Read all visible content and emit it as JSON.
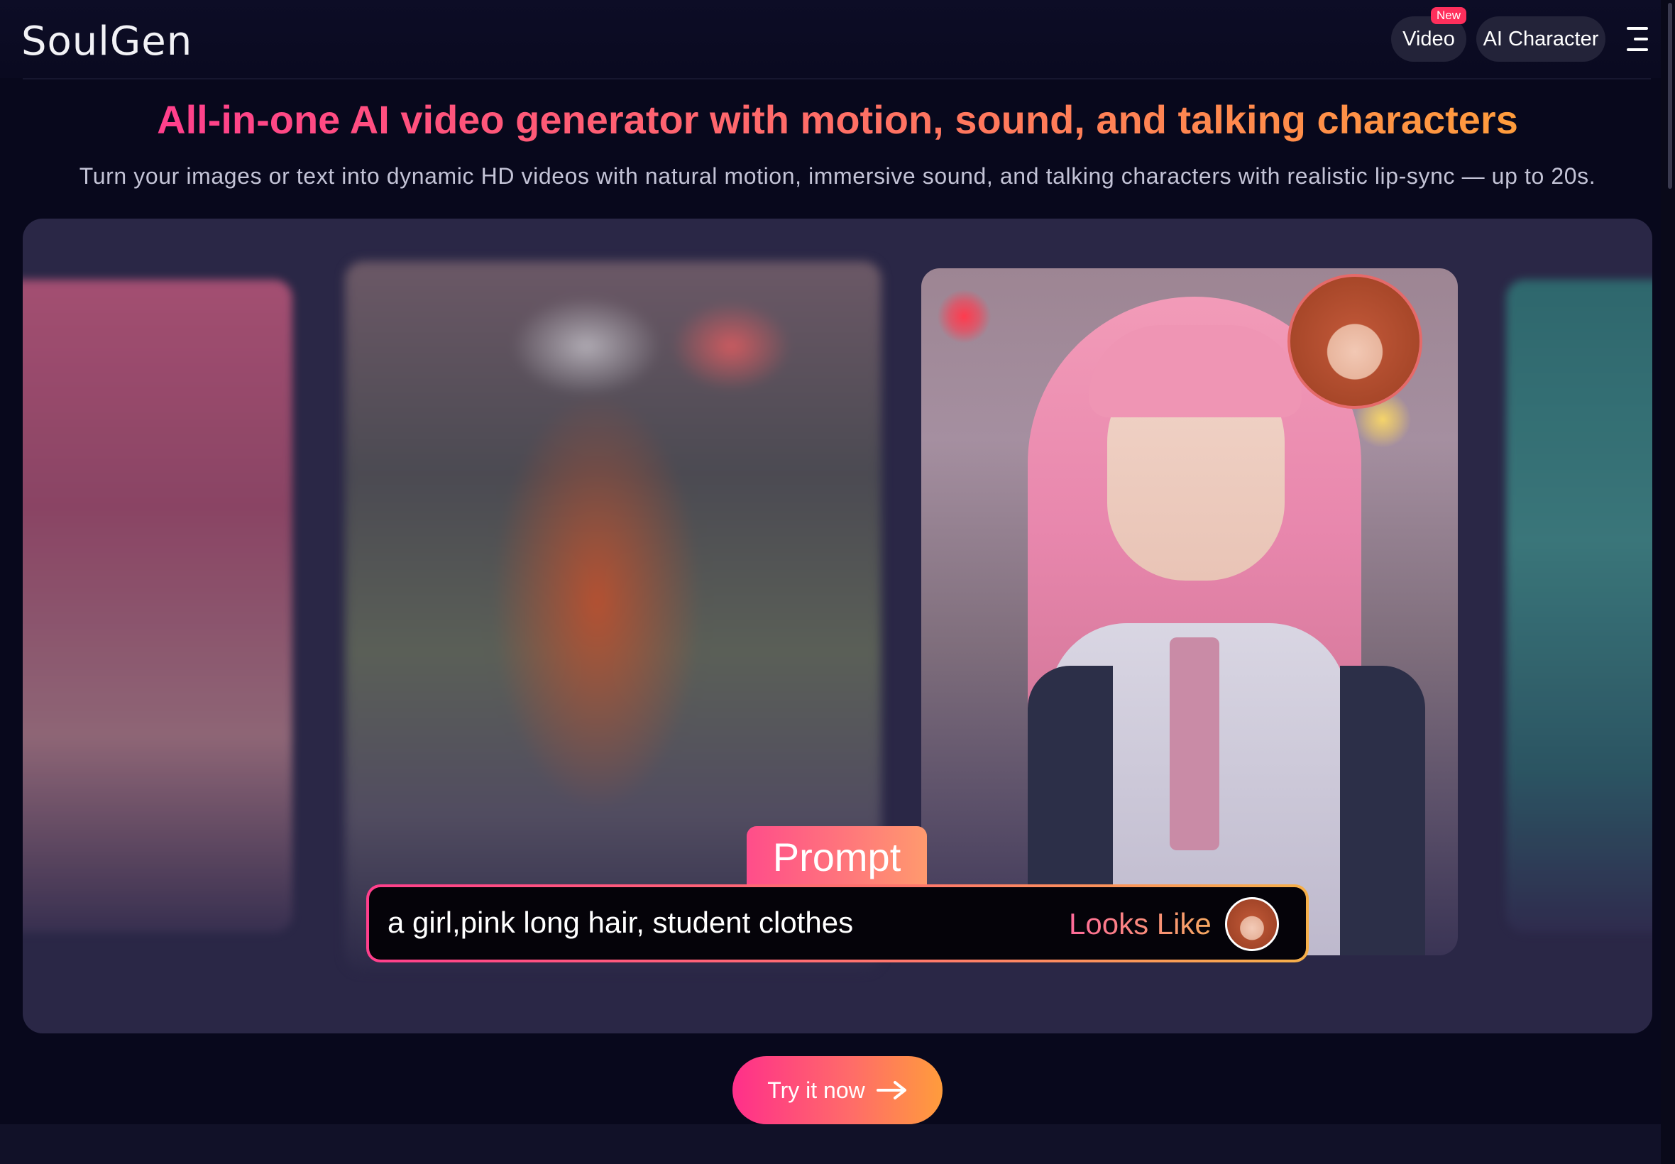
{
  "header": {
    "logo": "SoulGen",
    "nav": {
      "video_label": "Video",
      "video_badge": "New",
      "ai_character_label": "AI Character"
    },
    "menu_icon": "hamburger-menu-icon"
  },
  "hero": {
    "headline": "All-in-one AI video generator with motion, sound, and talking characters",
    "subheadline": "Turn your images or text into dynamic HD videos with natural motion, immersive sound, and talking characters with realistic lip-sync — up to 20s."
  },
  "showcase": {
    "prompt_tab": "Prompt",
    "prompt_text": "a girl,pink long hair, student clothes",
    "looks_like_label": "Looks Like"
  },
  "cta": {
    "label": "Try it now",
    "icon": "arrow-right-icon"
  },
  "colors": {
    "background": "#08081c",
    "accent_start": "#ff3f8c",
    "accent_end": "#ff9c3c",
    "badge": "#ff2f5c",
    "panel": "#2a2746"
  }
}
